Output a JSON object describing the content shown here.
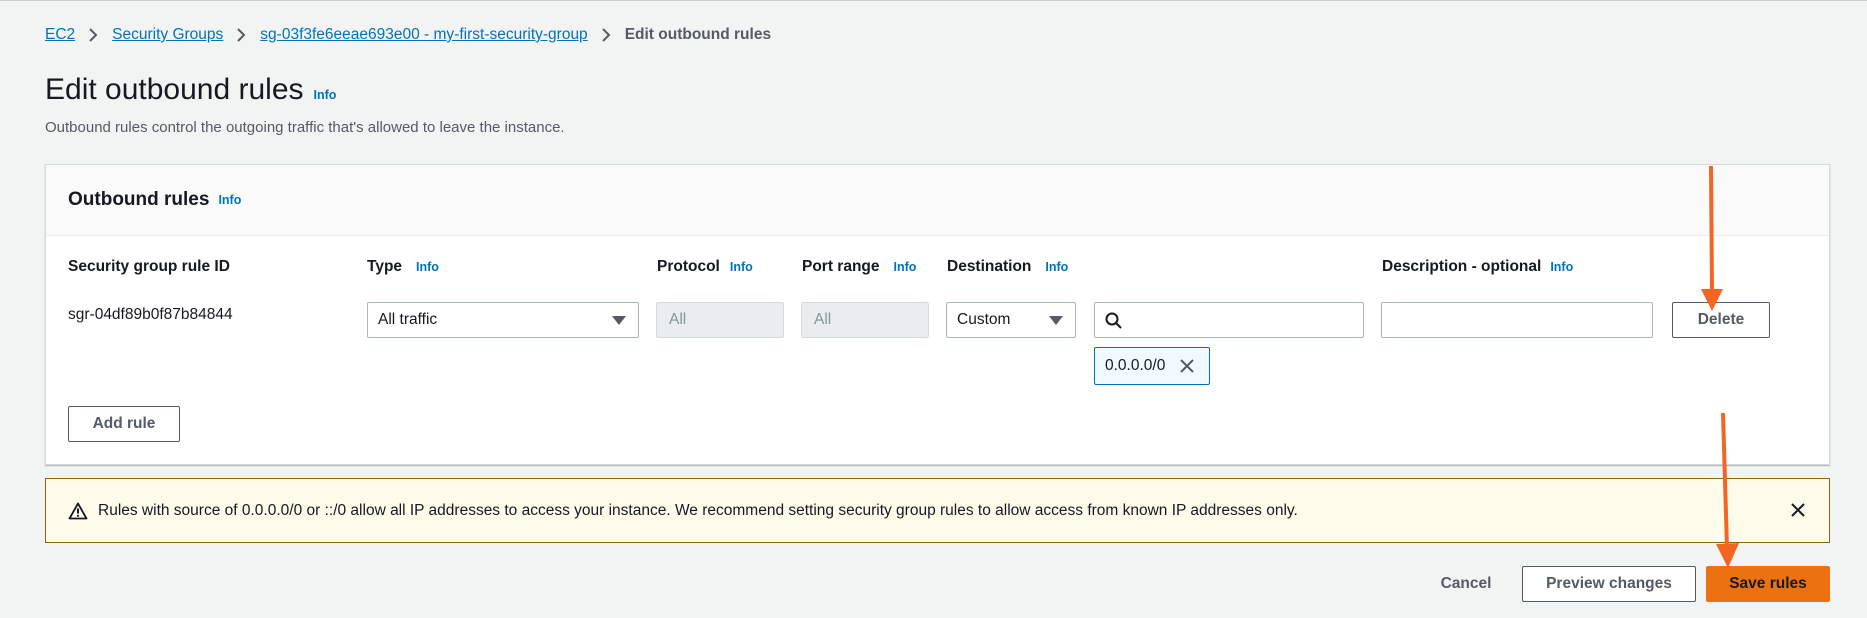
{
  "breadcrumb": {
    "items": [
      "EC2",
      "Security Groups",
      "sg-03f3fe6eeae693e00 - my-first-security-group"
    ],
    "current": "Edit outbound rules"
  },
  "page": {
    "title": "Edit outbound rules",
    "info": "Info",
    "description": "Outbound rules control the outgoing traffic that's allowed to leave the instance."
  },
  "panel": {
    "title": "Outbound rules",
    "info": "Info",
    "columns": {
      "rule_id": "Security group rule ID",
      "type": "Type",
      "protocol": "Protocol",
      "port_range": "Port range",
      "destination": "Destination",
      "description": "Description - optional",
      "info": "Info"
    },
    "row": {
      "rule_id": "sgr-04df89b0f87b84844",
      "type": "All traffic",
      "protocol": "All",
      "port_range": "All",
      "destination": "Custom",
      "search_value": "",
      "token": "0.0.0.0/0",
      "description_value": "",
      "delete_label": "Delete"
    },
    "add_rule_label": "Add rule"
  },
  "warning": {
    "text": "Rules with source of 0.0.0.0/0 or ::/0 allow all IP addresses to access your instance. We recommend setting security group rules to allow access from known IP addresses only."
  },
  "footer": {
    "cancel_label": "Cancel",
    "preview_label": "Preview changes",
    "save_label": "Save rules"
  },
  "colors": {
    "primary_button": "#ec7211",
    "link": "#0073bb",
    "annotation_arrow": "#f26522",
    "warning_bg": "#fffbeb"
  },
  "icons": {
    "breadcrumb_separator": "chevron-right-icon",
    "dropdown": "caret-down-icon",
    "search": "search-icon",
    "token_remove": "close-icon",
    "warning": "warning-icon",
    "dismiss": "close-icon"
  }
}
